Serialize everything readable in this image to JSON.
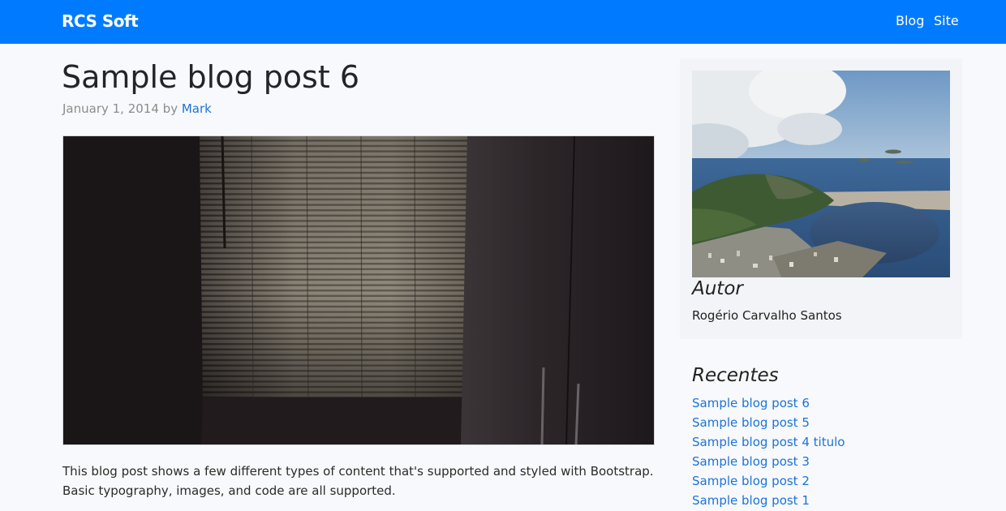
{
  "navbar": {
    "brand": "RCS Soft",
    "links": [
      {
        "label": "Blog"
      },
      {
        "label": "Site"
      }
    ]
  },
  "post": {
    "title": "Sample blog post 6",
    "date": "January 1, 2014",
    "by": "by",
    "author": "Mark",
    "body": "This blog post shows a few different types of content that's supported and styled with Bootstrap. Basic typography, images, and code are all supported."
  },
  "sidebar": {
    "author_heading": "Autor",
    "author_name": "Rogério Carvalho Santos",
    "recent_heading": "Recentes",
    "recent_posts": [
      {
        "label": "Sample blog post 6"
      },
      {
        "label": "Sample blog post 5"
      },
      {
        "label": "Sample blog post 4 titulo"
      },
      {
        "label": "Sample blog post 3"
      },
      {
        "label": "Sample blog post 2"
      },
      {
        "label": "Sample blog post 1"
      }
    ]
  },
  "colors": {
    "navbar": "#007bff",
    "link": "#1a73d9",
    "page_background": "#f8f9fc"
  }
}
